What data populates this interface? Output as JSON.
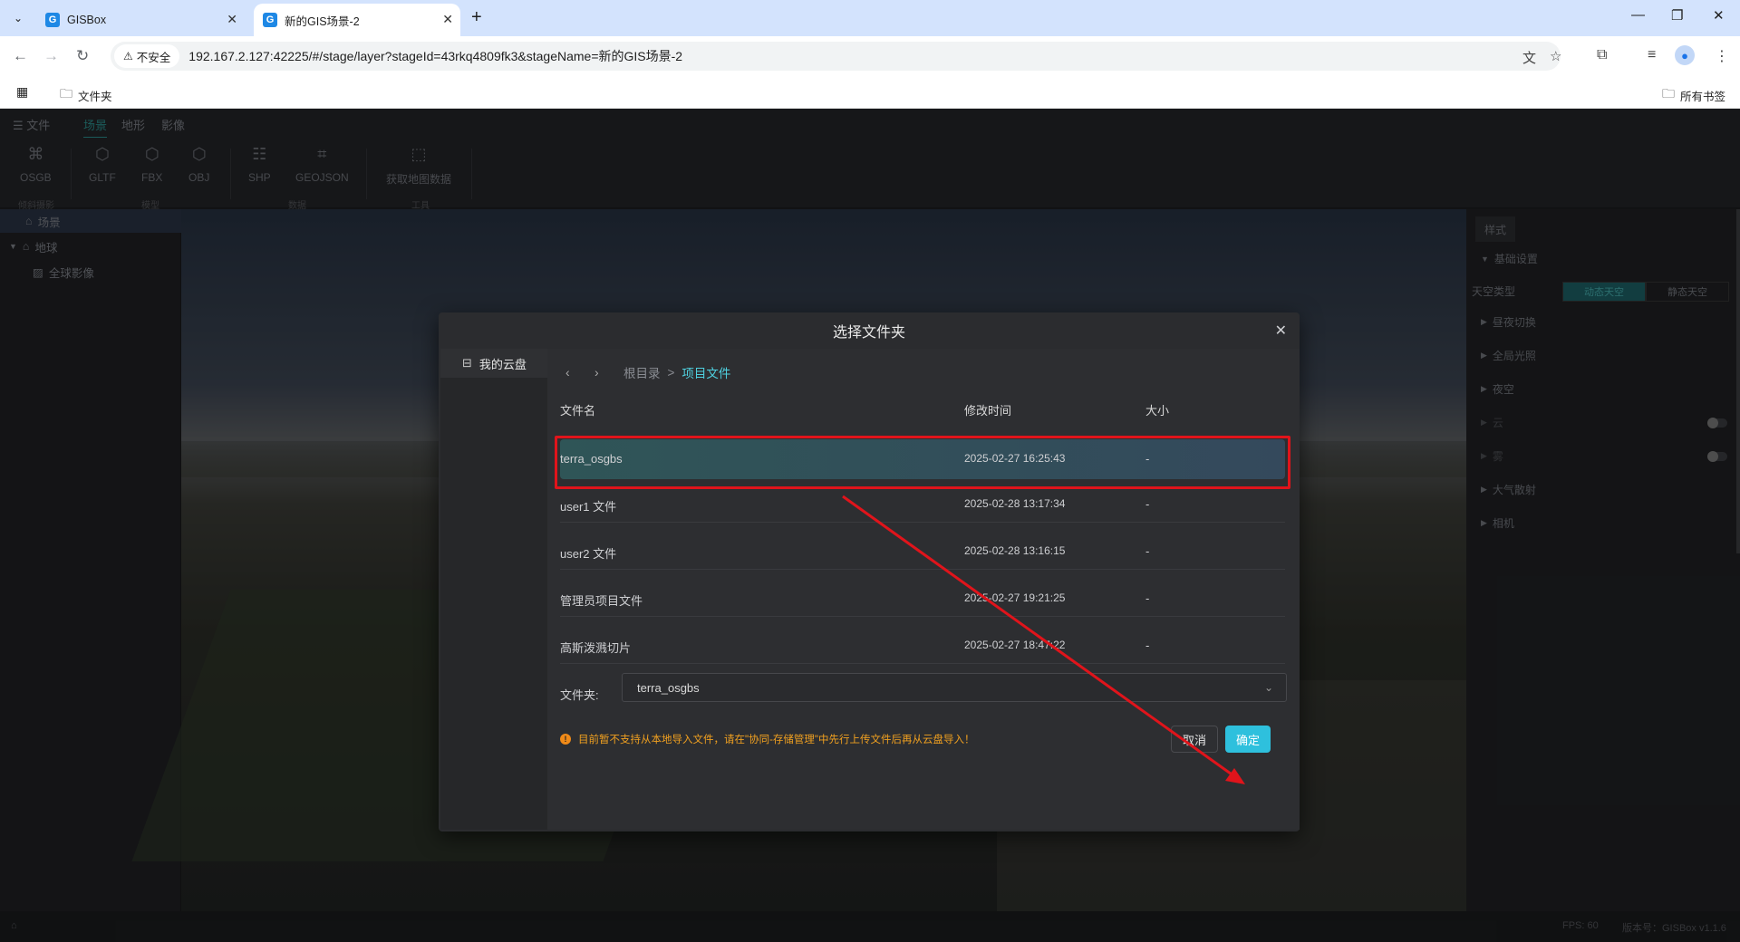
{
  "browser": {
    "tabs": [
      {
        "title": "GISBox",
        "favicon": "G"
      },
      {
        "title": "新的GIS场景-2",
        "favicon": "G"
      }
    ],
    "security_label": "不安全",
    "url": "192.167.2.127:42225/#/stage/layer?stageId=43rkq4809fk3&stageName=新的GIS场景-2",
    "bookmarks": {
      "folder": "文件夹",
      "all": "所有书签"
    }
  },
  "app": {
    "menu": [
      {
        "label": "☰ 文件"
      },
      {
        "label": "场景"
      },
      {
        "label": "地形"
      },
      {
        "label": "影像"
      }
    ],
    "ribbon": {
      "tools": [
        "OSGB",
        "GLTF",
        "FBX",
        "OBJ",
        "SHP",
        "GEOJSON",
        "获取地图数据"
      ],
      "groups": [
        "倾斜摄影",
        "模型",
        "数据",
        "工具"
      ]
    },
    "tree": [
      {
        "label": "场景"
      },
      {
        "label": "地球"
      },
      {
        "label": "全球影像"
      }
    ],
    "style_panel": {
      "tab": "样式",
      "section": "基础设置",
      "sky_type_label": "天空类型",
      "sky_options": [
        "动态天空",
        "静态天空"
      ],
      "items": [
        "昼夜切换",
        "全局光照",
        "夜空",
        "云",
        "雾",
        "大气散射",
        "相机"
      ]
    },
    "status": {
      "fps": "FPS: 60",
      "version": "版本号：GISBox v1.1.6"
    }
  },
  "dialog": {
    "title": "选择文件夹",
    "sidebar_item": "我的云盘",
    "breadcrumb": {
      "root": "根目录",
      "separator": ">",
      "current": "项目文件"
    },
    "columns": {
      "name": "文件名",
      "modified": "修改时间",
      "size": "大小"
    },
    "rows": [
      {
        "name": "terra_osgbs",
        "modified": "2025-02-27 16:25:43",
        "size": "-"
      },
      {
        "name": "user1 文件",
        "modified": "2025-02-28 13:17:34",
        "size": "-"
      },
      {
        "name": "user2 文件",
        "modified": "2025-02-28 13:16:15",
        "size": "-"
      },
      {
        "name": "管理员项目文件",
        "modified": "2025-02-27 19:21:25",
        "size": "-"
      },
      {
        "name": "高斯泼溅切片",
        "modified": "2025-02-27 18:47:22",
        "size": "-"
      }
    ],
    "folder_label": "文件夹:",
    "folder_value": "terra_osgbs",
    "notice": "目前暂不支持从本地导入文件，请在\"协同-存储管理\"中先行上传文件后再从云盘导入！",
    "cancel": "取消",
    "ok": "确定"
  },
  "colors": {
    "accent": "#2ec0dd",
    "annotation": "#e0141b",
    "warning": "#f0a020"
  }
}
